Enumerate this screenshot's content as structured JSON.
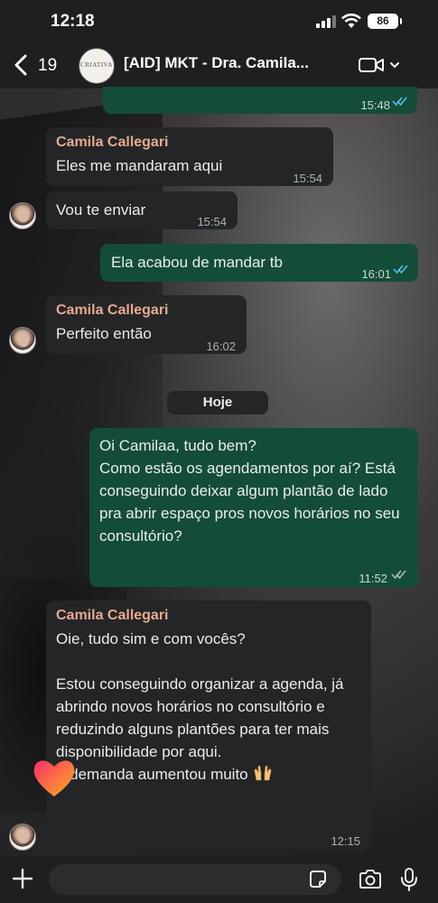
{
  "status_bar": {
    "time": "12:18",
    "battery": "86"
  },
  "header": {
    "back_count": "19",
    "avatar_text": "CRIATIVA",
    "title": "[AID] MKT - Dra. Camila..."
  },
  "messages": [
    {
      "direction": "out",
      "text": "",
      "time": "15:48",
      "read": true
    },
    {
      "direction": "in",
      "sender": "Camila Callegari",
      "text": "Eles me mandaram aqui",
      "time": "15:54"
    },
    {
      "direction": "in",
      "text": "Vou te enviar",
      "time": "15:54"
    },
    {
      "direction": "out",
      "text": "Ela acabou de mandar tb",
      "time": "16:01",
      "read": true
    },
    {
      "direction": "in",
      "sender": "Camila Callegari",
      "text": "Perfeito então",
      "time": "16:02"
    },
    {
      "direction": "out",
      "text": "Oi Camilaa, tudo bem?\nComo estão os agendamentos por aí? Está conseguindo deixar algum plantão de lado pra abrir espaço pros novos horários no seu consultório?",
      "time": "11:52",
      "read": false
    },
    {
      "direction": "in",
      "sender": "Camila Callegari",
      "text": "Oie, tudo sim e com vocês?\n\nEstou conseguindo organizar a agenda, já abrindo novos horários no consultório e reduzindo alguns plantões para ter mais disponibilidade por aqui.\nA demanda aumentou muito",
      "time": "12:15"
    }
  ],
  "date_separator": "Hoje",
  "input": {
    "value": ""
  },
  "colors": {
    "incoming_bubble": "#232526",
    "outgoing_bubble": "#144d37",
    "sender_name": "#e8a98f",
    "read_check": "#53bdeb"
  }
}
